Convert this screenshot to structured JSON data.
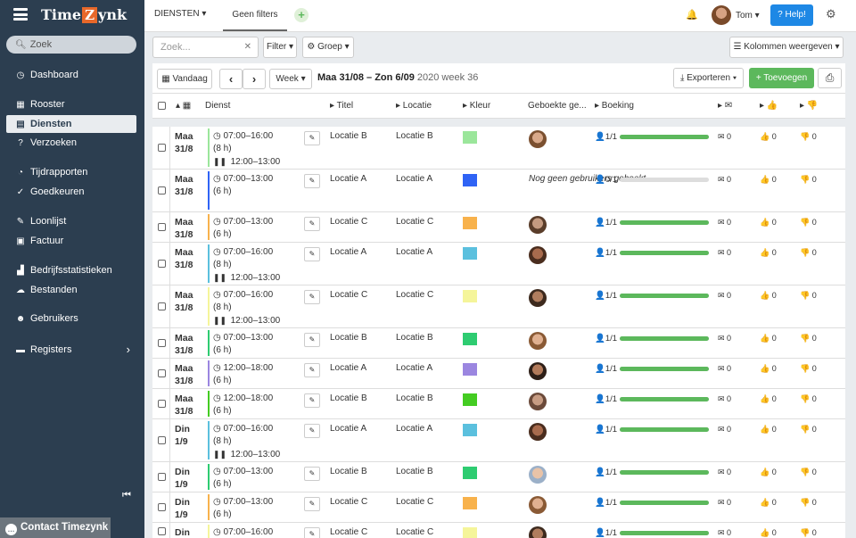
{
  "app": {
    "name_left": "Time",
    "name_z": "Z",
    "name_right": "ynk"
  },
  "sidebar": {
    "search_placeholder": "Zoek",
    "items": [
      {
        "label": "Dashboard",
        "icon": "dashboard-icon",
        "glyph": "◷"
      },
      {
        "label": "Rooster",
        "icon": "calendar-icon",
        "glyph": "▦"
      },
      {
        "label": "Diensten",
        "icon": "list-icon",
        "glyph": "▤",
        "active": true
      },
      {
        "label": "Verzoeken",
        "icon": "question-icon",
        "glyph": "?"
      },
      {
        "label": "Tijdrapporten",
        "icon": "clock-icon",
        "glyph": "◔"
      },
      {
        "label": "Goedkeuren",
        "icon": "thumbs-up-icon",
        "glyph": "✓"
      },
      {
        "label": "Loonlijst",
        "icon": "signature-icon",
        "glyph": "✎"
      },
      {
        "label": "Factuur",
        "icon": "invoice-icon",
        "glyph": "▣"
      },
      {
        "label": "Bedrijfsstatistieken",
        "icon": "bar-chart-icon",
        "glyph": "▟"
      },
      {
        "label": "Bestanden",
        "icon": "cloud-icon",
        "glyph": "☁"
      },
      {
        "label": "Gebruikers",
        "icon": "users-icon",
        "glyph": "☻"
      },
      {
        "label": "Registers",
        "icon": "folder-icon",
        "glyph": "▬",
        "chevron": "›"
      }
    ],
    "collapse_glyph": "⏮",
    "contact_label": "Contact Timezynk"
  },
  "topbar": {
    "tab_diensten": "DIENSTEN ▾",
    "tab_filter": "Geen filters",
    "add_glyph": "+",
    "bell_glyph": "🔔",
    "user_name": "Tom ▾",
    "help_label": "Help!",
    "gear_glyph": "⚙"
  },
  "toolbar1": {
    "search_placeholder": "Zoek...",
    "filter_label": "Filter ▾",
    "group_label": "Groep ▾",
    "columns_label": "Kolommen weergeven ▾"
  },
  "toolbar2": {
    "today_label": "Vandaag",
    "prev": "‹",
    "next": "›",
    "period_label": "Week ▾",
    "date_range": "Maa 31/08 – Zon 6/09",
    "week_label": "2020 week 36",
    "export_label": "Exporteren ▾",
    "add_label": "+ Toevoegen",
    "print_glyph": "⎙"
  },
  "columns": {
    "dienst": "Dienst",
    "titel": "▸ Titel",
    "locatie": "▸ Locatie",
    "kleur": "▸ Kleur",
    "geboekte": "Geboekte ge...",
    "boeking": "▸ Boeking",
    "c1": "▸ ✉",
    "c2": "▸ 👍",
    "c3": "▸ 👎"
  },
  "rows": [
    {
      "day": "Maa",
      "date": "31/8",
      "time": "07:00–16:00",
      "hours": "(8 h)",
      "break": "12:00–13:00",
      "titel": "Locatie B",
      "locatie": "Locatie B",
      "color": "#9be69b",
      "booked": "1/1",
      "fill": 1,
      "m": "0",
      "up": "0",
      "down": "0",
      "skin": "#d9a98a",
      "hair": "#7b5030"
    },
    {
      "day": "Maa",
      "date": "31/8",
      "time": "07:00–13:00",
      "hours": "(6 h)",
      "titel": "Locatie A",
      "locatie": "Locatie A",
      "color": "#2f63f5",
      "booked": "0/1",
      "fill": 0,
      "nobook": "Nog geen gebruikers geboekt",
      "m": "0",
      "up": "0",
      "down": "0"
    },
    {
      "day": "Maa",
      "date": "31/8",
      "time": "07:00–13:00",
      "hours": "(6 h)",
      "titel": "Locatie C",
      "locatie": "Locatie C",
      "color": "#f8b24c",
      "booked": "1/1",
      "fill": 1,
      "m": "0",
      "up": "0",
      "down": "0",
      "skin": "#c49a80",
      "hair": "#5a3d2a"
    },
    {
      "day": "Maa",
      "date": "31/8",
      "time": "07:00–16:00",
      "hours": "(8 h)",
      "break": "12:00–13:00",
      "titel": "Locatie A",
      "locatie": "Locatie A",
      "color": "#5bc0de",
      "booked": "1/1",
      "fill": 1,
      "m": "0",
      "up": "0",
      "down": "0",
      "skin": "#a86b4d",
      "hair": "#4a2d1e"
    },
    {
      "day": "Maa",
      "date": "31/8",
      "time": "07:00–16:00",
      "hours": "(8 h)",
      "break": "12:00–13:00",
      "titel": "Locatie C",
      "locatie": "Locatie C",
      "color": "#f5f59a",
      "booked": "1/1",
      "fill": 1,
      "m": "0",
      "up": "0",
      "down": "0",
      "skin": "#b07d5e",
      "hair": "#3d2a1e"
    },
    {
      "day": "Maa",
      "date": "31/8",
      "time": "07:00–13:00",
      "hours": "(6 h)",
      "titel": "Locatie B",
      "locatie": "Locatie B",
      "color": "#2ecc71",
      "booked": "1/1",
      "fill": 1,
      "m": "0",
      "up": "0",
      "down": "0",
      "skin": "#e0b090",
      "hair": "#8a5a35"
    },
    {
      "day": "Maa",
      "date": "31/8",
      "time": "12:00–18:00",
      "hours": "(6 h)",
      "titel": "Locatie A",
      "locatie": "Locatie A",
      "color": "#9b86e0",
      "booked": "1/1",
      "fill": 1,
      "m": "0",
      "up": "0",
      "down": "0",
      "skin": "#b27a5a",
      "hair": "#2e1f18"
    },
    {
      "day": "Maa",
      "date": "31/8",
      "time": "12:00–18:00",
      "hours": "(6 h)",
      "titel": "Locatie B",
      "locatie": "Locatie B",
      "color": "#44cc22",
      "booked": "1/1",
      "fill": 1,
      "m": "0",
      "up": "0",
      "down": "0",
      "skin": "#c79c83",
      "hair": "#6b4a3a"
    },
    {
      "day": "Din",
      "date": "1/9",
      "time": "07:00–16:00",
      "hours": "(8 h)",
      "break": "12:00–13:00",
      "titel": "Locatie A",
      "locatie": "Locatie A",
      "color": "#5bc0de",
      "booked": "1/1",
      "fill": 1,
      "m": "0",
      "up": "0",
      "down": "0",
      "skin": "#a86b4d",
      "hair": "#4a2d1e"
    },
    {
      "day": "Din",
      "date": "1/9",
      "time": "07:00–13:00",
      "hours": "(6 h)",
      "titel": "Locatie B",
      "locatie": "Locatie B",
      "color": "#2ecc71",
      "booked": "1/1",
      "fill": 1,
      "m": "0",
      "up": "0",
      "down": "0",
      "skin": "#e8c3a8",
      "hair": "#9bb0c8"
    },
    {
      "day": "Din",
      "date": "1/9",
      "time": "07:00–13:00",
      "hours": "(6 h)",
      "titel": "Locatie C",
      "locatie": "Locatie C",
      "color": "#f8b24c",
      "booked": "1/1",
      "fill": 1,
      "m": "0",
      "up": "0",
      "down": "0",
      "skin": "#e0b090",
      "hair": "#8a5a35"
    },
    {
      "day": "Din",
      "date": "1/9",
      "time": "07:00–16:00",
      "hours": "",
      "titel": "Locatie C",
      "locatie": "Locatie C",
      "color": "#f5f59a",
      "booked": "1/1",
      "fill": 1,
      "m": "0",
      "up": "0",
      "down": "0",
      "skin": "#b07d5e",
      "hair": "#3d2a1e"
    }
  ]
}
